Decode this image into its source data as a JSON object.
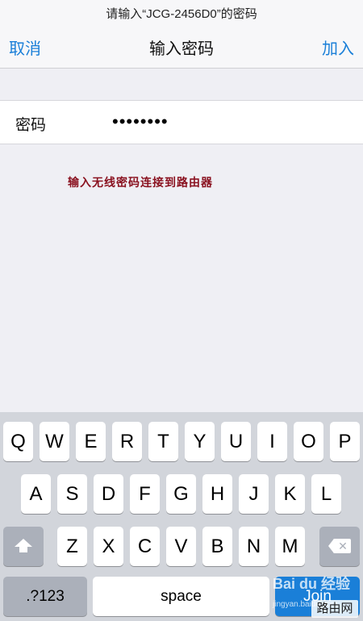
{
  "header": {
    "prompt": "请输入“JCG-2456D0”的密码",
    "cancel_label": "取消",
    "title": "输入密码",
    "join_label": "加入"
  },
  "password": {
    "label": "密码",
    "masked_value": "••••••••"
  },
  "annotation": "输入无线密码连接到路由器",
  "keyboard": {
    "row1": [
      "Q",
      "W",
      "E",
      "R",
      "T",
      "Y",
      "U",
      "I",
      "O",
      "P"
    ],
    "row2": [
      "A",
      "S",
      "D",
      "F",
      "G",
      "H",
      "J",
      "K",
      "L"
    ],
    "row3": [
      "Z",
      "X",
      "C",
      "V",
      "B",
      "N",
      "M"
    ],
    "shift_icon": "shift-arrow-icon",
    "delete_icon": "delete-backspace-icon",
    "numbers_label": ".?123",
    "space_label": "space",
    "join_label": "Join"
  },
  "watermark": {
    "brand": "Bai du 经验",
    "url": "jingyan.baidu.com",
    "tag": "路由网"
  },
  "colors": {
    "accent": "#1a7fd8",
    "annotation": "#8a1220",
    "keyboard_bg": "#d2d5db",
    "function_key": "#abb0ba"
  }
}
